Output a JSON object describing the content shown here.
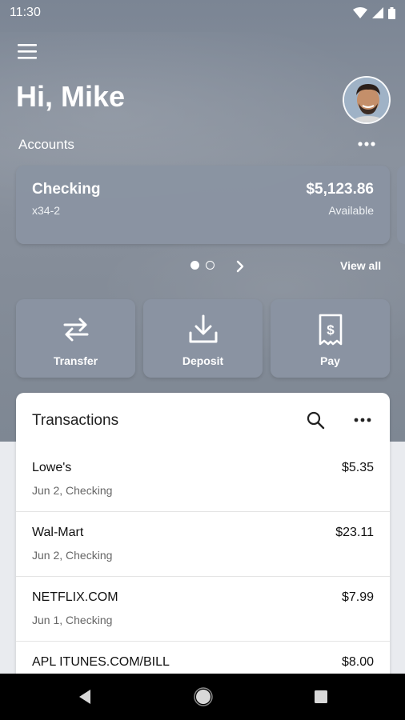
{
  "status_bar": {
    "time": "11:30"
  },
  "header": {
    "greeting": "Hi, Mike"
  },
  "accounts": {
    "label": "Accounts",
    "cards": [
      {
        "name": "Checking",
        "number": "x34-2",
        "balance": "$5,123.86",
        "balance_label": "Available"
      }
    ],
    "pager": {
      "active_index": 0,
      "count": 2
    },
    "view_all": "View all"
  },
  "actions": [
    {
      "label": "Transfer",
      "icon": "transfer-icon"
    },
    {
      "label": "Deposit",
      "icon": "deposit-icon"
    },
    {
      "label": "Pay",
      "icon": "pay-icon"
    }
  ],
  "transactions": {
    "title": "Transactions",
    "items": [
      {
        "merchant": "Lowe's",
        "detail": "Jun 2, Checking",
        "amount": "$5.35"
      },
      {
        "merchant": "Wal-Mart",
        "detail": "Jun 2, Checking",
        "amount": "$23.11"
      },
      {
        "merchant": "NETFLIX.COM",
        "detail": "Jun 1, Checking",
        "amount": "$7.99"
      },
      {
        "merchant": "APL ITUNES.COM/BILL",
        "detail": "",
        "amount": "$8.00"
      }
    ]
  },
  "colors": {
    "hero": "#858d99",
    "card": "#8a94a2",
    "page_bg": "#e9ebef"
  }
}
